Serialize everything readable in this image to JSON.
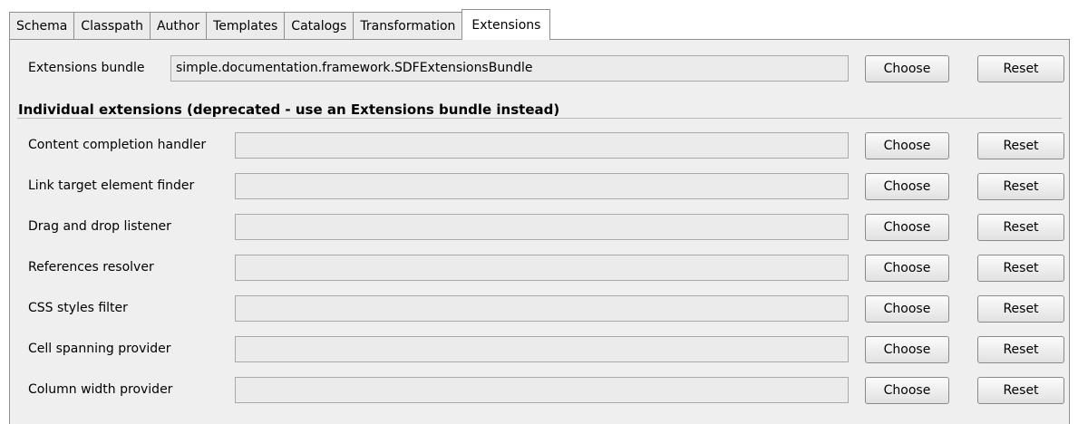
{
  "tabs": [
    {
      "label": "Schema"
    },
    {
      "label": "Classpath"
    },
    {
      "label": "Author"
    },
    {
      "label": "Templates"
    },
    {
      "label": "Catalogs"
    },
    {
      "label": "Transformation"
    },
    {
      "label": "Extensions",
      "active": true
    }
  ],
  "bundle": {
    "label": "Extensions bundle",
    "value": "simple.documentation.framework.SDFExtensionsBundle",
    "choose_label": "Choose",
    "reset_label": "Reset"
  },
  "section_title": "Individual extensions (deprecated - use an Extensions bundle instead)",
  "extensions": [
    {
      "label": "Content completion handler",
      "value": "",
      "choose_label": "Choose",
      "reset_label": "Reset"
    },
    {
      "label": "Link target element finder",
      "value": "",
      "choose_label": "Choose",
      "reset_label": "Reset"
    },
    {
      "label": "Drag and drop listener",
      "value": "",
      "choose_label": "Choose",
      "reset_label": "Reset"
    },
    {
      "label": "References resolver",
      "value": "",
      "choose_label": "Choose",
      "reset_label": "Reset"
    },
    {
      "label": "CSS styles filter",
      "value": "",
      "choose_label": "Choose",
      "reset_label": "Reset"
    },
    {
      "label": "Cell spanning provider",
      "value": "",
      "choose_label": "Choose",
      "reset_label": "Reset"
    },
    {
      "label": "Column width provider",
      "value": "",
      "choose_label": "Choose",
      "reset_label": "Reset"
    }
  ]
}
